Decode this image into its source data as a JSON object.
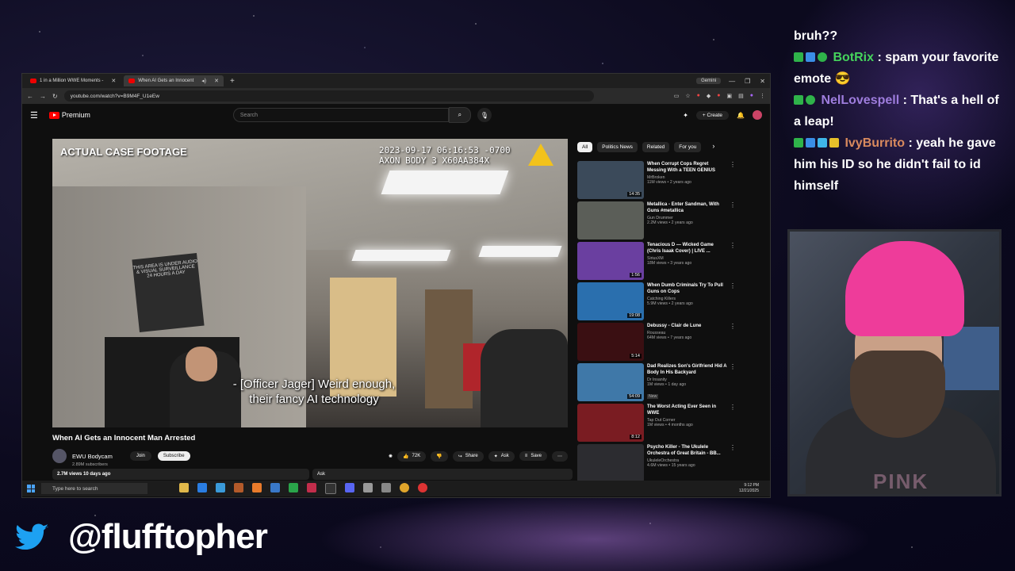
{
  "browser": {
    "tabs": [
      {
        "label": "1 in a Million WWE Moments -"
      },
      {
        "label": "When AI Gets an Innocent"
      }
    ],
    "gemini_label": "Gemini",
    "url": "youtube.com/watch?v=B9M4F_U1eEw"
  },
  "youtube": {
    "brand": "Premium",
    "search_placeholder": "Search",
    "create_label": "Create",
    "video": {
      "hud_left": "ACTUAL CASE FOOTAGE",
      "hud_timestamp": "2023-09-17 06:16:53 -0700",
      "hud_device": "AXON BODY 3 X60AA384X",
      "sign_text": "THIS AREA IS UNDER AUDIO & VISUAL SURVEILLANCE 24 HOURS A DAY",
      "caption_line1": "- [Officer Jager] Weird enough,",
      "caption_line2": "their fancy AI technology"
    },
    "title": "When AI Gets an Innocent Man Arrested",
    "channel": {
      "name": "EWU Bodycam",
      "subs": "2.89M subscribers"
    },
    "join_label": "Join",
    "subscribe_label": "Subscribe",
    "likes": "72K",
    "share_label": "Share",
    "ask_label": "Ask",
    "save_label": "Save",
    "meta": "2.7M views  10 days ago",
    "ask_bar": "Ask",
    "chips": [
      "All",
      "Politics News",
      "Related",
      "For you"
    ],
    "recommendations": [
      {
        "title": "When Corrupt Cops Regret Messing With a TEEN GENIUS",
        "channel": "MrBroken",
        "views": "11M views • 2 years ago",
        "duration": "14:35",
        "thumb_color": "#3b4a5a"
      },
      {
        "title": "Metallica - Enter Sandman, With Guns #metallica",
        "channel": "Gun Drummer",
        "views": "2.2M views • 2 years ago",
        "duration": "",
        "thumb_color": "#5b5e58"
      },
      {
        "title": "Tenacious D — Wicked Game (Chris Isaak Cover) | LIVE ...",
        "channel": "SiriusXM",
        "views": "18M views • 3 years ago",
        "duration": "1:56",
        "thumb_color": "#6a3fa0"
      },
      {
        "title": "When Dumb Criminals Try To Pull Guns on Cops",
        "channel": "Catching Killers",
        "views": "5.9M views • 2 years ago",
        "duration": "19:08",
        "thumb_color": "#2a6fae"
      },
      {
        "title": "Debussy - Clair de Lune",
        "channel": "Rousseau",
        "views": "64M views • 7 years ago",
        "duration": "5:14",
        "thumb_color": "#3a0f12"
      },
      {
        "title": "Dad Realizes Son's Girlfriend Hid A Body In His Backyard",
        "channel": "Dr Insanity",
        "views": "1M views • 1 day ago",
        "duration": "54:09",
        "thumb_color": "#3f78a8"
      },
      {
        "title": "The Worst Acting Ever Seen in WWE",
        "channel": "Tap Out Corner",
        "views": "1M views • 4 months ago",
        "duration": "8:12",
        "thumb_color": "#7a1c22"
      },
      {
        "title": "Psycho Killer - The Ukulele Orchestra of Great Britain - BB...",
        "channel": "UkuleleOrchestra",
        "views": "4.6M views • 15 years ago",
        "duration": "",
        "thumb_color": "#2c2c30"
      }
    ],
    "new_badge": "New"
  },
  "taskbar": {
    "search_placeholder": "Type here to search",
    "time": "9:12 PM",
    "date": "12/21/2025"
  },
  "chat": {
    "line0": "bruh??",
    "messages": [
      {
        "user": "BotRix",
        "text": ": spam your favorite emote 😎"
      },
      {
        "user": "NelLovespell",
        "text": ": That's a hell of a leap!"
      },
      {
        "user": "IvyBurrito",
        "text": ": yeah he gave him his ID so he didn't fail to id himself"
      }
    ]
  },
  "webcam": {
    "hat_text": "PINK"
  },
  "social": {
    "handle": "@flufftopher"
  }
}
